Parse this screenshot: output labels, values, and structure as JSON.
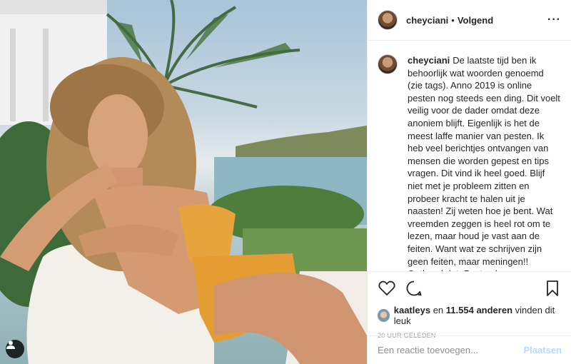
{
  "post": {
    "username": "cheyciani",
    "separator": "•",
    "follow_label": "Volgend",
    "more_label": "···",
    "caption": "De laatste tijd ben ik behoorlijk wat woorden genoemd (zie tags). Anno 2019 is online pesten nog steeds een ding. Dit voelt veilig voor de dader omdat deze anoniem blijft. Eigenlijk is het de meest laffe manier van pesten. Ik heb veel berichtjes ontvangen van mensen die worden gepest en tips vragen. Dit vind ik heel goed. Blijf niet met je probleem zitten en probeer kracht te halen uit je naasten! Zij weten hoe je bent. Wat vreemden zeggen is heel rot om te lezen, maar houd je vast aan de feiten. Want wat ze schrijven zijn geen feiten, maar meningen!! Onthoud dat. Pesten kan een vorm van jaloezie zijn of afgunst, voortvloeiend uit eigen ontevredenheid. Een persoon die goed in z'n vel zit en positief is ingesteld zal",
    "likes": {
      "liker": "kaatleys",
      "connector": "en",
      "count_text": "11.554 anderen",
      "suffix": "vinden dit leuk"
    },
    "timestamp": "20 UUR GELEDEN"
  },
  "comment": {
    "placeholder": "Een reactie toevoegen...",
    "post_label": "Plaatsen"
  },
  "icons": {
    "like": "heart-icon",
    "comment": "comment-icon",
    "save": "bookmark-icon",
    "tags": "user-tag-icon",
    "more": "more-options-icon"
  },
  "colors": {
    "text": "#262626",
    "muted": "#8e8e8e",
    "border": "#efefef",
    "post_disabled": "#b3dbff",
    "bikini": "#e8a43c"
  }
}
